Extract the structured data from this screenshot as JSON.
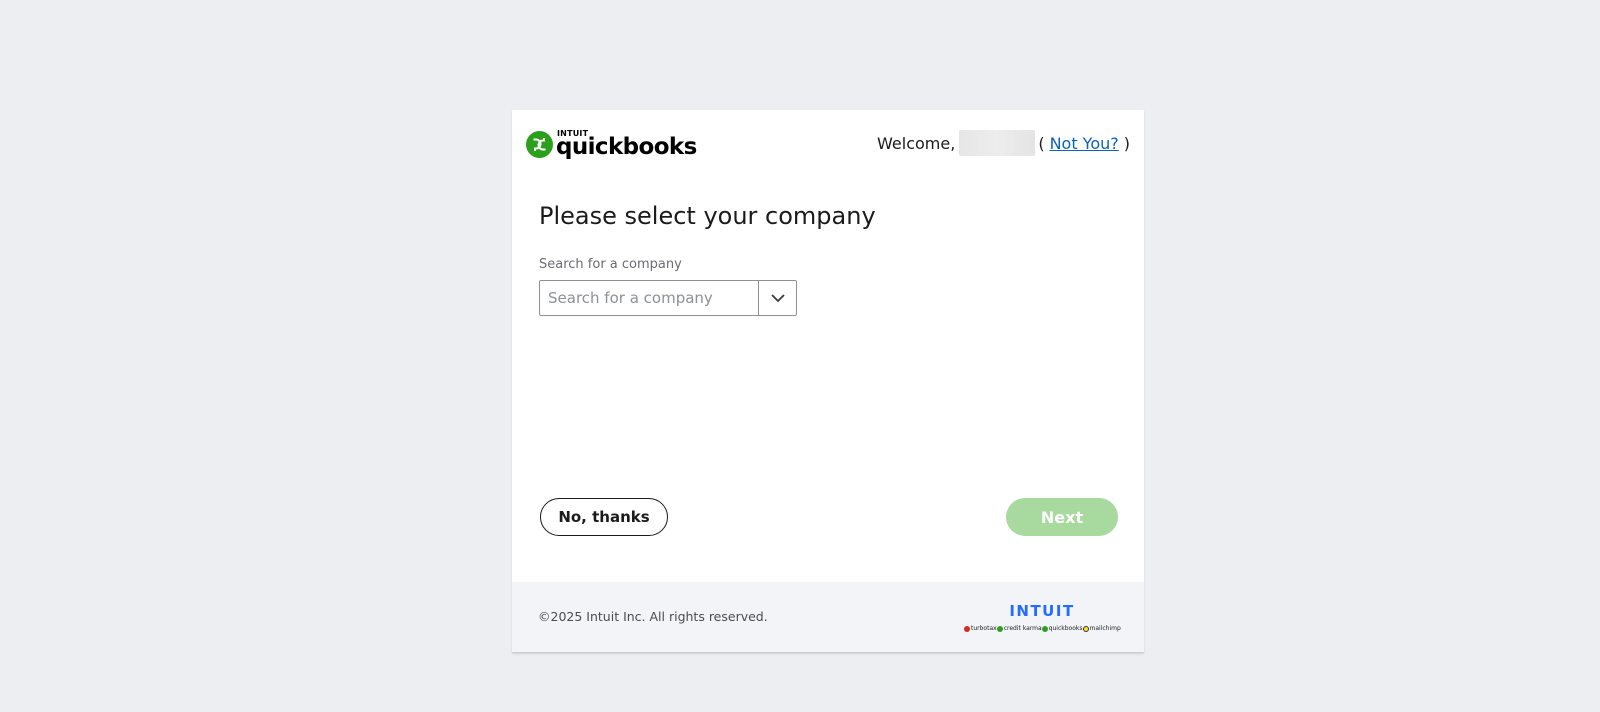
{
  "header": {
    "logo_top": "INTUIT",
    "logo_name": "quickbooks",
    "welcome_text": "Welcome,",
    "open_paren": "(",
    "not_you_link": "Not You?",
    "close_paren": ")"
  },
  "main": {
    "title": "Please select your company",
    "search_label": "Search for a company",
    "search_placeholder": "Search for a company",
    "search_value": ""
  },
  "actions": {
    "secondary_label": "No, thanks",
    "primary_label": "Next",
    "primary_enabled": false
  },
  "footer": {
    "copyright": "©2025 Intuit Inc. All rights reserved.",
    "brand": "INTUIT",
    "products": [
      {
        "label": "turbotax",
        "color": "#d52b1e"
      },
      {
        "label": "credit karma",
        "color": "#2ca01c"
      },
      {
        "label": "quickbooks",
        "color": "#2ca01c"
      },
      {
        "label": "mailchimp",
        "color": "#ffe01b"
      }
    ]
  },
  "colors": {
    "accent_green": "#2ca01c",
    "disabled_green": "#a8d99f",
    "link_blue": "#0b62b8",
    "intuit_blue": "#236cff"
  }
}
